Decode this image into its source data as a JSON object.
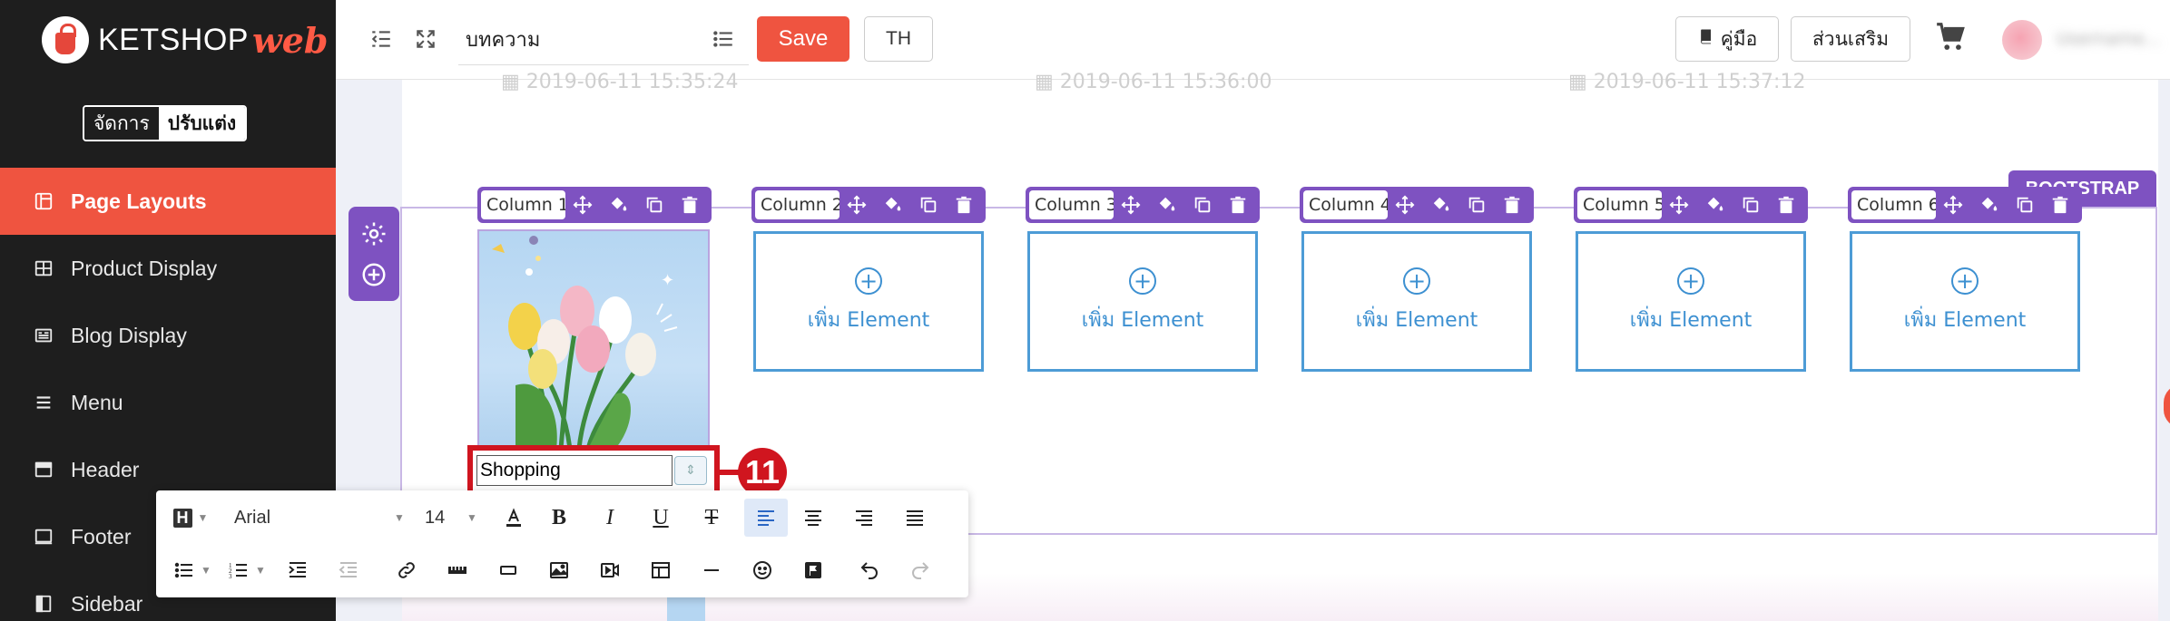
{
  "sidebar": {
    "logo": {
      "text": "KETSHOP",
      "accent": "web"
    },
    "mode_toggle": {
      "manage": "จัดการ",
      "design": "ปรับแต่ง"
    },
    "items": [
      {
        "label": "Page Layouts",
        "icon": "layout-icon",
        "active": true
      },
      {
        "label": "Product Display",
        "icon": "grid-icon",
        "active": false
      },
      {
        "label": "Blog Display",
        "icon": "newspaper-icon",
        "active": false
      },
      {
        "label": "Menu",
        "icon": "menu-icon",
        "active": false
      },
      {
        "label": "Header",
        "icon": "header-icon",
        "active": false
      },
      {
        "label": "Footer",
        "icon": "footer-icon",
        "active": false
      },
      {
        "label": "Sidebar",
        "icon": "sidebar-icon",
        "active": false
      }
    ]
  },
  "topbar": {
    "title_value": "บทความ",
    "save_label": "Save",
    "lang_label": "TH",
    "guide_label": "คู่มือ",
    "addon_label": "ส่วนเสริม",
    "user_name": "Username..."
  },
  "canvas": {
    "dates": [
      "2019-06-11 15:35:24",
      "2019-06-11 15:36:00",
      "2019-06-11 15:37:12"
    ],
    "bootstrap_tag": "BOOTSTRAP",
    "columns": [
      {
        "label": "Column 1"
      },
      {
        "label": "Column 2",
        "add_text": "เพิ่ม Element"
      },
      {
        "label": "Column 3",
        "add_text": "เพิ่ม Element"
      },
      {
        "label": "Column 4",
        "add_text": "เพิ่ม Element"
      },
      {
        "label": "Column 5",
        "add_text": "เพิ่ม Element"
      },
      {
        "label": "Column 6",
        "add_text": "เพิ่ม Element"
      }
    ],
    "image_caption_value": "Shopping",
    "callout_number": "11"
  },
  "editor_toolbar": {
    "heading_label": "H",
    "font_family": "Arial",
    "font_size": "14"
  },
  "colors": {
    "accent": "#ef5440",
    "purple": "#7e52c1",
    "blue": "#4d9cd6",
    "callout_red": "#d0151f",
    "sidebar_bg": "#1e1e1e"
  }
}
